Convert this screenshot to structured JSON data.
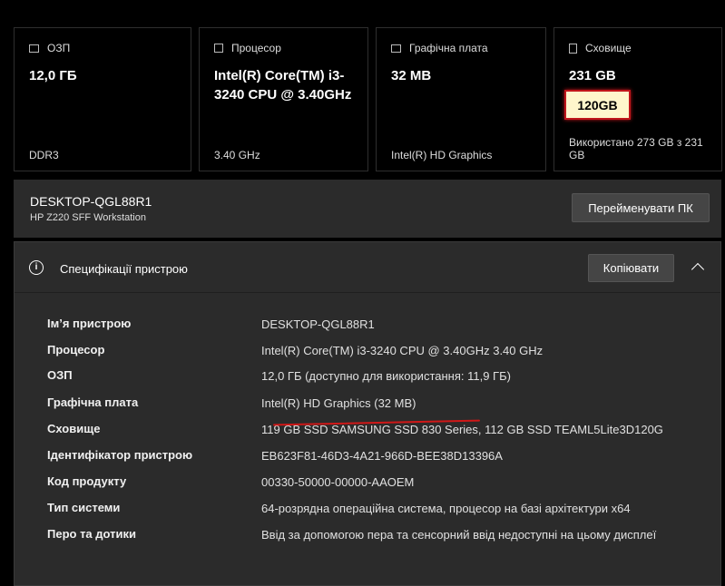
{
  "cards": [
    {
      "label": "ОЗП",
      "value": "12,0 ГБ",
      "sub": "DDR3",
      "icon": "ram-icon"
    },
    {
      "label": "Процесор",
      "value": "Intel(R) Core(TM) i3-3240 CPU @ 3.40GHz",
      "sub": "3.40 GHz",
      "icon": "cpu-icon"
    },
    {
      "label": "Графічна плата",
      "value": "32 MB",
      "sub": "Intel(R) HD Graphics",
      "icon": "gpu-icon"
    },
    {
      "label": "Сховище",
      "value": "231 GB",
      "sub": "Використано 273 GB з 231 GB",
      "icon": "storage-icon",
      "annotation": "120GB"
    }
  ],
  "device": {
    "name": "DESKTOP-QGL88R1",
    "model": "HP Z220 SFF Workstation",
    "rename_label": "Перейменувати ПК"
  },
  "specs": {
    "title": "Специфікації пристрою",
    "copy_label": "Копіювати",
    "rows": [
      {
        "label": "Ім’я пристрою",
        "value": "DESKTOP-QGL88R1"
      },
      {
        "label": "Процесор",
        "value": "Intel(R) Core(TM) i3-3240 CPU @ 3.40GHz   3.40 GHz"
      },
      {
        "label": "ОЗП",
        "value": "12,0 ГБ (доступно для використання: 11,9 ГБ)"
      },
      {
        "label": "Графічна плата",
        "value": "Intel(R) HD Graphics (32 MB)"
      },
      {
        "label": "Сховище",
        "value": "119 GB SSD SAMSUNG SSD 830 Series, 112 GB SSD TEAML5Lite3D120G"
      },
      {
        "label": "Ідентифікатор пристрою",
        "value": "EB623F81-46D3-4A21-966D-BEE38D13396A"
      },
      {
        "label": "Код продукту",
        "value": "00330-50000-00000-AAOEM"
      },
      {
        "label": "Тип системи",
        "value": "64-розрядна операційна система, процесор на базі архітектури x64"
      },
      {
        "label": "Перо та дотики",
        "value": "Ввід за допомогою пера та сенсорний ввід недоступні на цьому дисплеї"
      }
    ]
  }
}
